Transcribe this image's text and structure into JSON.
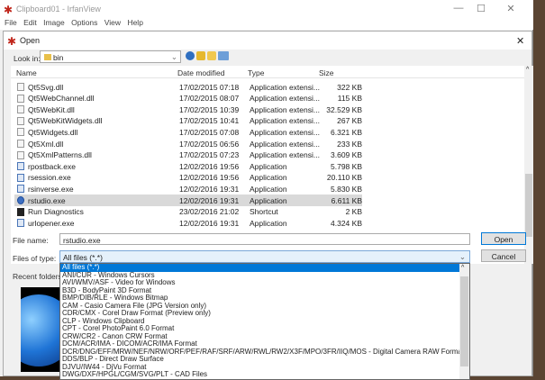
{
  "window": {
    "title": "Clipboard01 - IrfanView",
    "controls": [
      "—",
      "☐",
      "✕"
    ]
  },
  "menu": [
    "File",
    "Edit",
    "Image",
    "Options",
    "View",
    "Help"
  ],
  "dialog": {
    "title": "Open",
    "close": "✕",
    "look_in_label": "Look in:",
    "look_in_value": "bin",
    "columns": [
      "Name",
      "Date modified",
      "Type",
      "Size"
    ],
    "files": [
      {
        "name": "Qt5Svg.dll",
        "date": "17/02/2015 07:18",
        "type": "Application extensi...",
        "size": "322 KB",
        "icon": "dll"
      },
      {
        "name": "Qt5WebChannel.dll",
        "date": "17/02/2015 08:07",
        "type": "Application extensi...",
        "size": "115 KB",
        "icon": "dll"
      },
      {
        "name": "Qt5WebKit.dll",
        "date": "17/02/2015 10:39",
        "type": "Application extensi...",
        "size": "32.529 KB",
        "icon": "dll"
      },
      {
        "name": "Qt5WebKitWidgets.dll",
        "date": "17/02/2015 10:41",
        "type": "Application extensi...",
        "size": "267 KB",
        "icon": "dll"
      },
      {
        "name": "Qt5Widgets.dll",
        "date": "17/02/2015 07:08",
        "type": "Application extensi...",
        "size": "6.321 KB",
        "icon": "dll"
      },
      {
        "name": "Qt5Xml.dll",
        "date": "17/02/2015 06:56",
        "type": "Application extensi...",
        "size": "233 KB",
        "icon": "dll"
      },
      {
        "name": "Qt5XmlPatterns.dll",
        "date": "17/02/2015 07:23",
        "type": "Application extensi...",
        "size": "3.609 KB",
        "icon": "dll"
      },
      {
        "name": "rpostback.exe",
        "date": "12/02/2016 19:56",
        "type": "Application",
        "size": "5.798 KB",
        "icon": "exe"
      },
      {
        "name": "rsession.exe",
        "date": "12/02/2016 19:56",
        "type": "Application",
        "size": "20.110 KB",
        "icon": "exe"
      },
      {
        "name": "rsinverse.exe",
        "date": "12/02/2016 19:31",
        "type": "Application",
        "size": "5.830 KB",
        "icon": "exe"
      },
      {
        "name": "rstudio.exe",
        "date": "12/02/2016 19:31",
        "type": "Application",
        "size": "6.611 KB",
        "icon": "r",
        "selected": true
      },
      {
        "name": "Run Diagnostics",
        "date": "23/02/2016 21:02",
        "type": "Shortcut",
        "size": "2 KB",
        "icon": "lnk"
      },
      {
        "name": "urlopener.exe",
        "date": "12/02/2016 19:31",
        "type": "Application",
        "size": "4.324 KB",
        "icon": "exe"
      }
    ],
    "file_name_label": "File name:",
    "file_name_value": "rstudio.exe",
    "file_type_label": "Files of type:",
    "file_type_value": "All files (*.*)",
    "recent_folders_label": "Recent folders:",
    "open_label": "Open",
    "cancel_label": "Cancel",
    "file_type_options": [
      "All files (*.*)",
      "ANI/CUR - Windows Cursors",
      "AVI/WMV/ASF - Video for Windows",
      "B3D - BodyPaint 3D Format",
      "BMP/DIB/RLE - Windows Bitmap",
      "CAM - Casio Camera File (JPG Version only)",
      "CDR/CMX - Corel Draw Format (Preview only)",
      "CLP - Windows Clipboard",
      "CPT - Corel PhotoPaint 6.0 Format",
      "CRW/CR2 - Canon CRW Format",
      "DCM/ACR/IMA - DICOM/ACR/IMA Format",
      "DCR/DNG/EFF/MRW/NEF/NRW/ORF/PEF/RAF/SRF/ARW/RWL/RW2/X3F/MPO/3FR/IIQ/MOS - Digital Camera RAW Format",
      "DDS/BLP - Direct Draw Surface",
      "DJVU/IW44 - DjVu Format",
      "DWG/DXF/HPGL/CGM/SVG/PLT - CAD Files"
    ]
  },
  "colors": {
    "accent": "#0078d7",
    "selection": "#d9d9d9"
  }
}
